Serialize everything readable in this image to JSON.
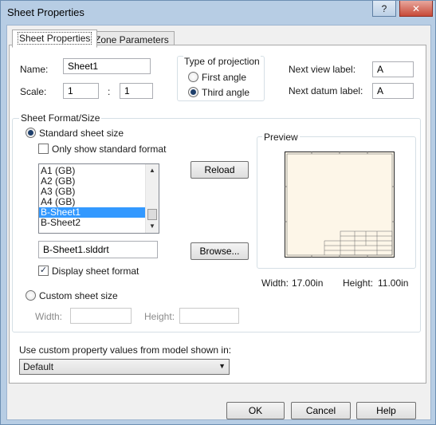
{
  "window": {
    "title": "Sheet Properties",
    "help_glyph": "?",
    "close_glyph": "✕"
  },
  "tabs": [
    {
      "label": "Sheet Properties",
      "active": true
    },
    {
      "label": "Zone Parameters",
      "active": false
    }
  ],
  "general": {
    "name_label": "Name:",
    "name_value": "Sheet1",
    "scale_label": "Scale:",
    "scale_num": "1",
    "scale_sep": ":",
    "scale_den": "1"
  },
  "projection": {
    "title": "Type of projection",
    "options": [
      {
        "label": "First angle",
        "selected": false
      },
      {
        "label": "Third angle",
        "selected": true
      }
    ]
  },
  "labels": {
    "next_view_label": "Next view label:",
    "next_view_value": "A",
    "next_datum_label": "Next datum label:",
    "next_datum_value": "A"
  },
  "sheet_format": {
    "title": "Sheet Format/Size",
    "standard_label": "Standard sheet size",
    "standard_selected": true,
    "only_standard_label": "Only show standard format",
    "only_standard_checked": false,
    "reload_label": "Reload",
    "list_items": [
      "A1 (GB)",
      "A2 (GB)",
      "A3 (GB)",
      "A4 (GB)",
      "B-Sheet1",
      "B-Sheet2"
    ],
    "selected_index": 4,
    "file_value": "B-Sheet1.slddrt",
    "browse_label": "Browse...",
    "display_format_label": "Display sheet format",
    "display_format_checked": true,
    "custom_label": "Custom sheet size",
    "custom_selected": false,
    "width_label": "Width:",
    "height_label": "Height:"
  },
  "preview": {
    "title": "Preview",
    "width_label": "Width:",
    "width_value": "17.00in",
    "height_label": "Height:",
    "height_value": "11.00in"
  },
  "custom_property": {
    "label": "Use custom property values from model shown in:",
    "selected": "Default"
  },
  "buttons": {
    "ok": "OK",
    "cancel": "Cancel",
    "help": "Help"
  },
  "colors": {
    "selection": "#3399ff",
    "sheet_fill": "#fdf6e8",
    "frame": "#b7cde4"
  }
}
